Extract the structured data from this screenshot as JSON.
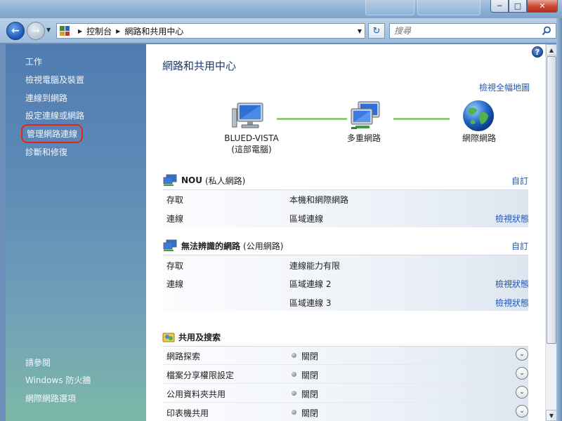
{
  "window": {
    "minimize_glyph": "─",
    "maximize_glyph": "□",
    "close_glyph": "✕"
  },
  "nav": {
    "breadcrumb": [
      "控制台",
      "網路和共用中心"
    ],
    "search_placeholder": "搜尋"
  },
  "sidebar": {
    "tasks_heading": "工作",
    "tasks": [
      "檢視電腦及裝置",
      "連線到網路",
      "設定連線或網路",
      "管理網路連線",
      "診斷和修復"
    ],
    "see_also_heading": "請參閱",
    "see_also": [
      "Windows 防火牆",
      "網際網路選項"
    ]
  },
  "main": {
    "title": "網路和共用中心",
    "full_map_link": "檢視全幅地圖",
    "map": {
      "computer_name": "BLUED-VISTA",
      "computer_sub": "(這部電腦)",
      "middle_label": "多重網路",
      "internet_label": "網際網路"
    },
    "network1": {
      "name": "NOU",
      "type": "(私人網路)",
      "customize": "自訂",
      "access_label": "存取",
      "access_value": "本機和網際網路",
      "conn_label": "連線",
      "conn_value": "區域連線",
      "view_status": "檢視狀態"
    },
    "network2": {
      "name": "無法辨識的網路",
      "type": "(公用網路)",
      "customize": "自訂",
      "access_label": "存取",
      "access_value": "連線能力有限",
      "conn_label": "連線",
      "conn_value_1": "區域連線 2",
      "conn_value_2": "區域連線 3",
      "view_status_1": "檢視狀態",
      "view_status_2": "檢視狀態"
    },
    "sharing": {
      "heading": "共用及搜索",
      "rows": [
        {
          "label": "網路探索",
          "status": "關閉"
        },
        {
          "label": "檔案分享權限設定",
          "status": "關閉"
        },
        {
          "label": "公用資料夾共用",
          "status": "關閉"
        },
        {
          "label": "印表機共用",
          "status": "關閉"
        }
      ]
    }
  },
  "colors": {
    "link": "#1e57b8",
    "title": "#1c3a72",
    "highlight_ring": "#e8211b"
  }
}
